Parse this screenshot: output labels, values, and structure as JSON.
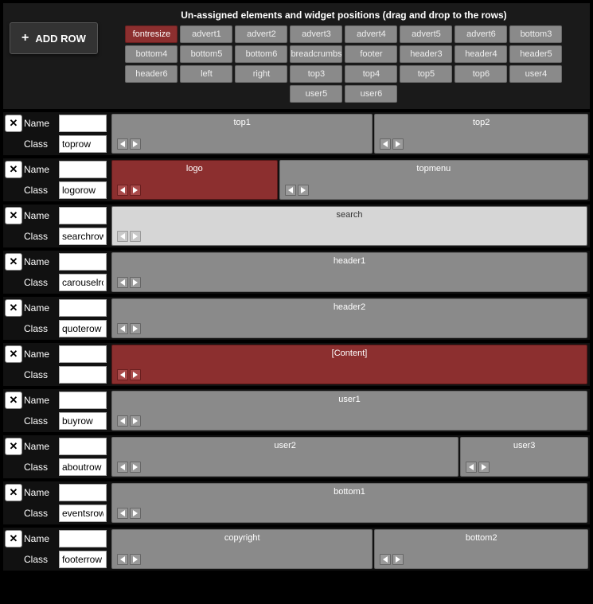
{
  "header": {
    "add_row_label": "ADD ROW",
    "pool_title": "Un-assigned elements and widget positions (drag and drop to the rows)"
  },
  "unassigned": [
    {
      "label": "fontresize",
      "active": true
    },
    {
      "label": "advert1"
    },
    {
      "label": "advert2"
    },
    {
      "label": "advert3"
    },
    {
      "label": "advert4"
    },
    {
      "label": "advert5"
    },
    {
      "label": "advert6"
    },
    {
      "label": "bottom3"
    },
    {
      "label": "bottom4"
    },
    {
      "label": "bottom5"
    },
    {
      "label": "bottom6"
    },
    {
      "label": "breadcrumbs"
    },
    {
      "label": "footer"
    },
    {
      "label": "header3"
    },
    {
      "label": "header4"
    },
    {
      "label": "header5"
    },
    {
      "label": "header6"
    },
    {
      "label": "left"
    },
    {
      "label": "right"
    },
    {
      "label": "top3"
    },
    {
      "label": "top4"
    },
    {
      "label": "top5"
    },
    {
      "label": "top6"
    },
    {
      "label": "user4"
    },
    {
      "label": "user5"
    },
    {
      "label": "user6"
    }
  ],
  "labels": {
    "name": "Name",
    "class": "Class"
  },
  "rows": [
    {
      "name": "",
      "class": "toprow",
      "cells": [
        {
          "label": "top1",
          "w": 55
        },
        {
          "label": "top2",
          "w": 45
        }
      ]
    },
    {
      "name": "",
      "class": "logorow",
      "cells": [
        {
          "label": "logo",
          "w": 35,
          "style": "red"
        },
        {
          "label": "topmenu",
          "w": 65
        }
      ]
    },
    {
      "name": "",
      "class": "searchrow",
      "cells": [
        {
          "label": "search",
          "w": 100,
          "style": "light"
        }
      ]
    },
    {
      "name": "",
      "class": "carouselrow",
      "cells": [
        {
          "label": "header1",
          "w": 100
        }
      ]
    },
    {
      "name": "",
      "class": "quoterow",
      "cells": [
        {
          "label": "header2",
          "w": 100
        }
      ]
    },
    {
      "name": "",
      "class": "",
      "cells": [
        {
          "label": "[Content]",
          "w": 100,
          "style": "red"
        }
      ]
    },
    {
      "name": "",
      "class": "buyrow",
      "cells": [
        {
          "label": "user1",
          "w": 100
        }
      ]
    },
    {
      "name": "",
      "class": "aboutrow",
      "cells": [
        {
          "label": "user2",
          "w": 73
        },
        {
          "label": "user3",
          "w": 27
        }
      ]
    },
    {
      "name": "",
      "class": "eventsrow",
      "cells": [
        {
          "label": "bottom1",
          "w": 100
        }
      ]
    },
    {
      "name": "",
      "class": "footerrow",
      "cells": [
        {
          "label": "copyright",
          "w": 55
        },
        {
          "label": "bottom2",
          "w": 45
        }
      ]
    }
  ]
}
